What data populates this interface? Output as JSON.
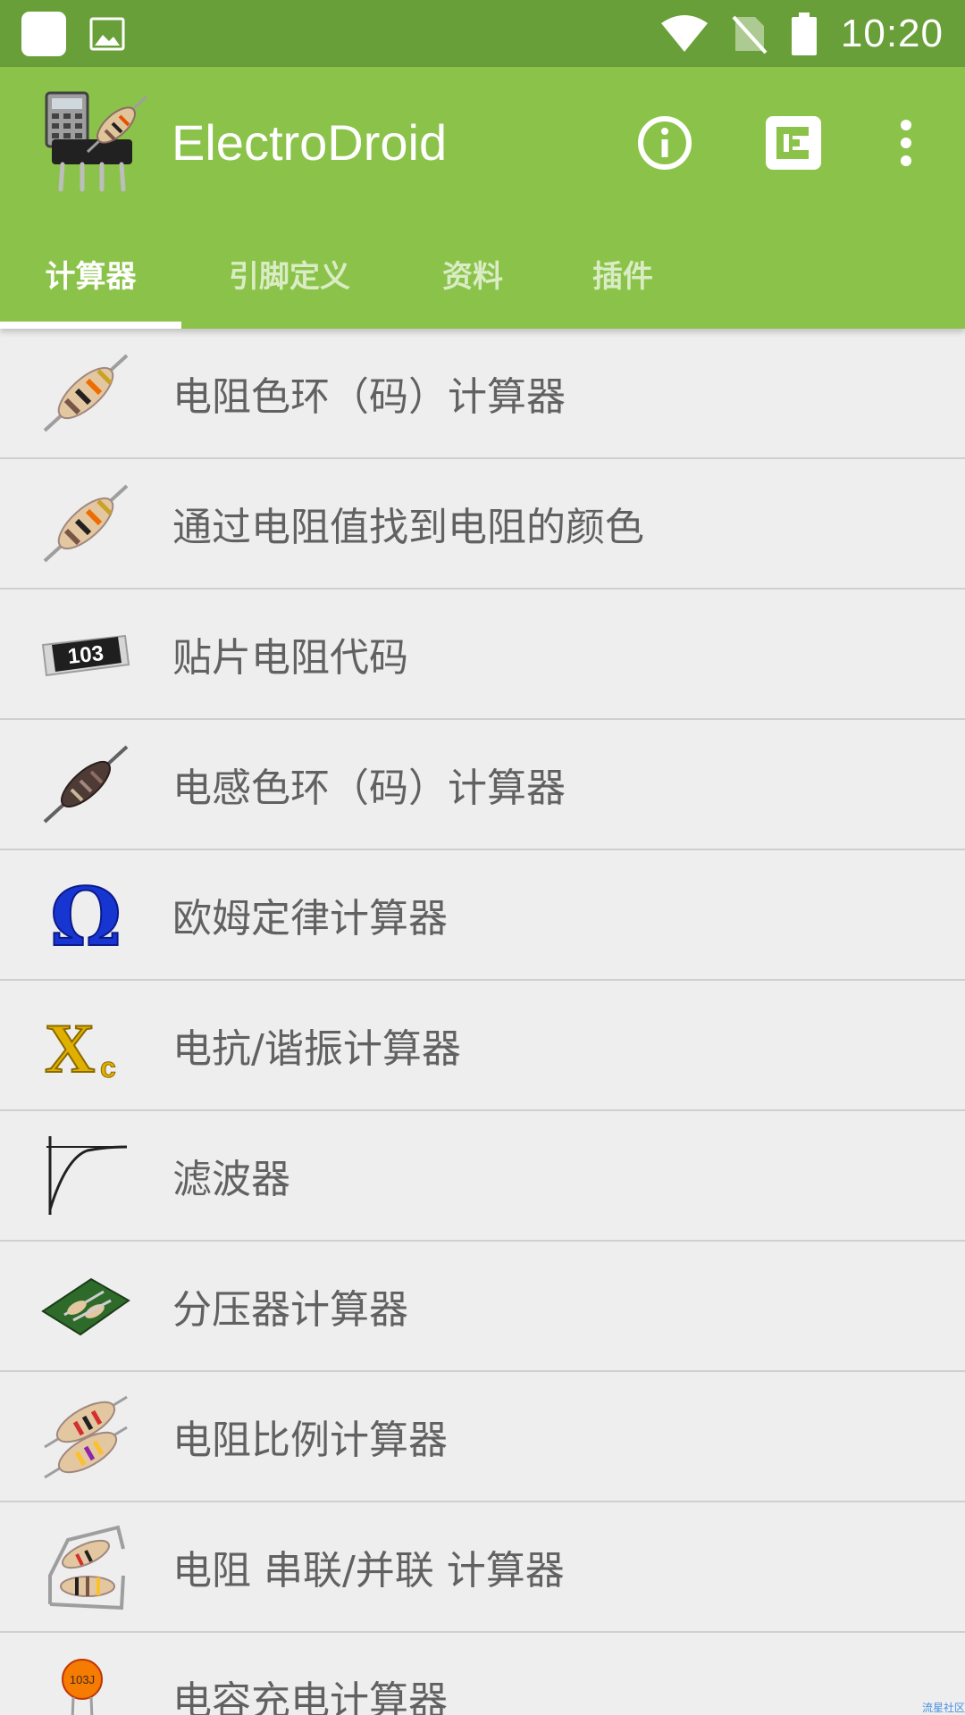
{
  "status_bar": {
    "time": "10:20",
    "icons": [
      "notification-square-icon",
      "image-icon",
      "wifi-icon",
      "no-sim-icon",
      "battery-icon"
    ]
  },
  "app_bar": {
    "title": "ElectroDroid",
    "actions": [
      "info-icon",
      "plugin-icon",
      "overflow-menu-icon"
    ]
  },
  "tabs": [
    {
      "label": "计算器",
      "active": true
    },
    {
      "label": "引脚定义",
      "active": false
    },
    {
      "label": "资料",
      "active": false
    },
    {
      "label": "插件",
      "active": false
    }
  ],
  "calculators": [
    {
      "label": "电阻色环（码）计算器",
      "icon": "resistor-icon"
    },
    {
      "label": "通过电阻值找到电阻的颜色",
      "icon": "resistor-icon"
    },
    {
      "label": "贴片电阻代码",
      "icon": "smd-resistor-icon",
      "icon_text": "103"
    },
    {
      "label": "电感色环（码）计算器",
      "icon": "inductor-icon"
    },
    {
      "label": "欧姆定律计算器",
      "icon": "ohm-icon",
      "icon_text": "Ω"
    },
    {
      "label": "电抗/谐振计算器",
      "icon": "reactance-icon",
      "icon_text": "X",
      "icon_sub": "c"
    },
    {
      "label": "滤波器",
      "icon": "filter-curve-icon"
    },
    {
      "label": "分压器计算器",
      "icon": "voltage-divider-icon"
    },
    {
      "label": "电阻比例计算器",
      "icon": "resistor-ratio-icon"
    },
    {
      "label": "电阻 串联/并联 计算器",
      "icon": "series-parallel-icon"
    },
    {
      "label": "电容充电计算器",
      "icon": "capacitor-icon",
      "icon_text": "103J"
    }
  ],
  "watermark": "流星社区",
  "colors": {
    "status_bar": "#689f38",
    "app_bar": "#8bc34a",
    "background": "#eeeeee",
    "text": "#616161"
  }
}
